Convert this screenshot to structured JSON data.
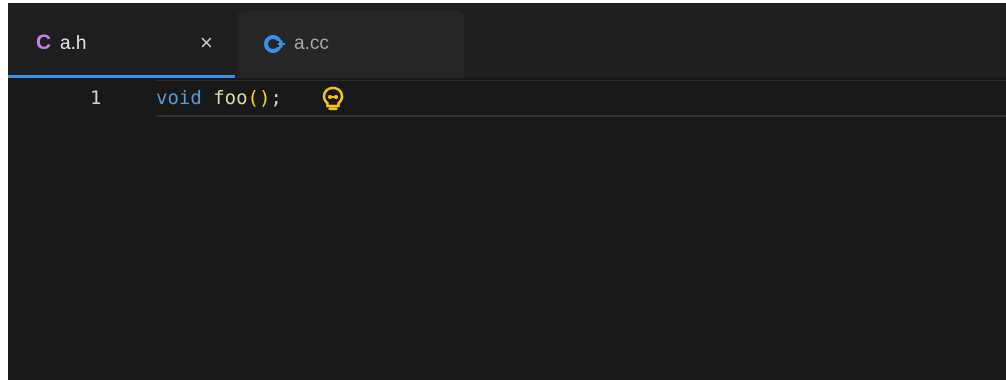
{
  "tabs": [
    {
      "icon": "c-language-icon",
      "label": "a.h",
      "active": true,
      "close_glyph": "×"
    },
    {
      "icon": "cpp-language-icon",
      "label": "a.cc",
      "active": false
    }
  ],
  "editor": {
    "lines": [
      {
        "number": "1",
        "tokens": {
          "keyword": "void",
          "space": " ",
          "func": "foo",
          "parens": "()",
          "semicolon": ";"
        }
      }
    ],
    "lightbulb_icon": "lightbulb-icon"
  },
  "colors": {
    "c_icon": "#c67ff5",
    "cpp_icon": "#3b8eea",
    "active_tab_underline": "#3b8eea",
    "keyword": "#569cd6",
    "function": "#dcdcaa",
    "bracket": "#ffd700",
    "lightbulb": "#f5c518"
  }
}
